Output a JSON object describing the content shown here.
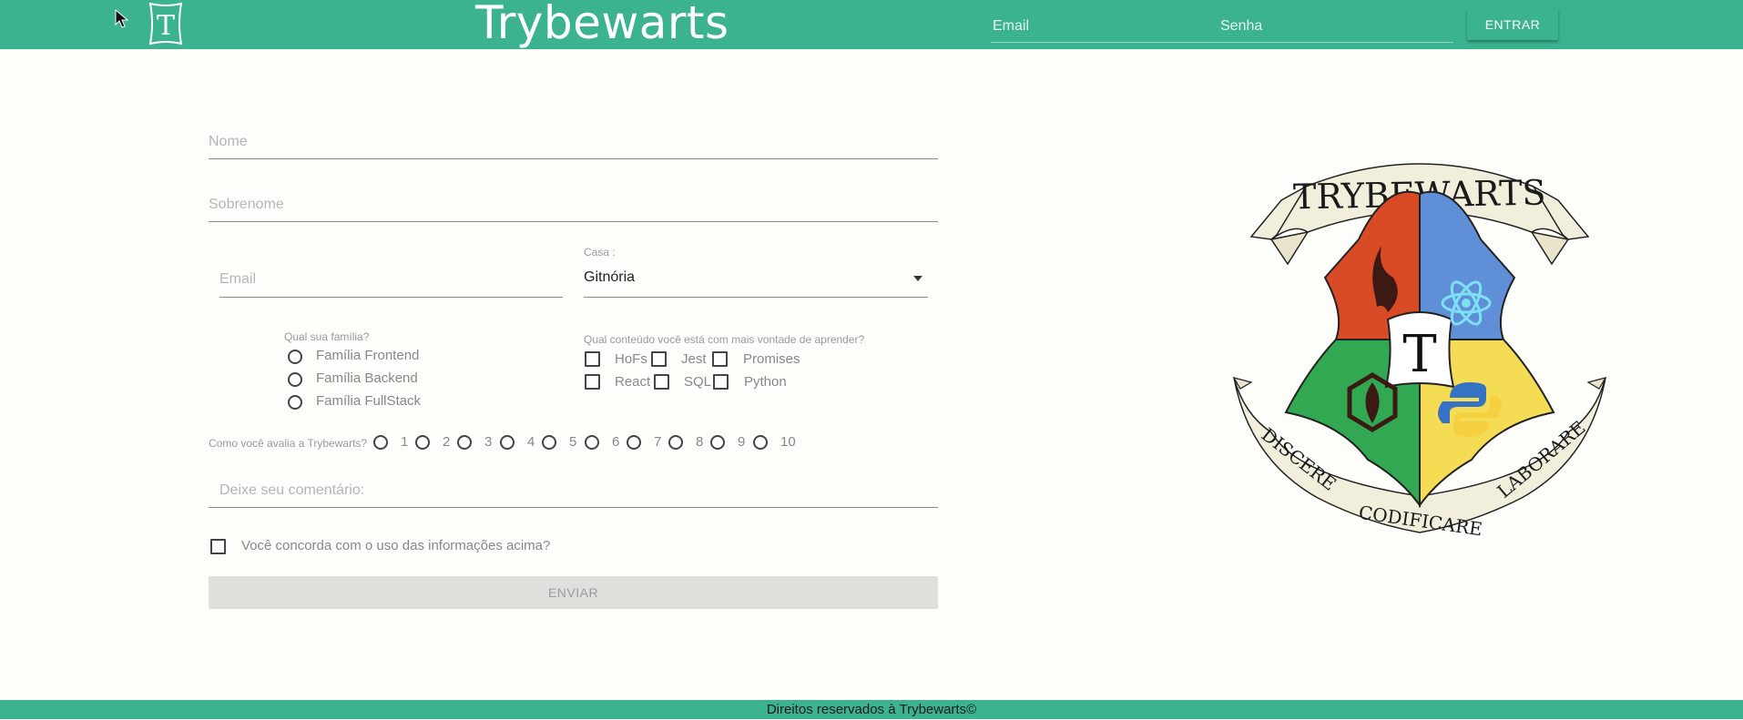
{
  "header": {
    "brand": "Trybewarts",
    "logo_letter": "T",
    "email_placeholder": "Email",
    "password_placeholder": "Senha",
    "login_button": "ENTRAR"
  },
  "form": {
    "name_placeholder": "Nome",
    "surname_placeholder": "Sobrenome",
    "email_placeholder": "Email",
    "house_label": "Casa :",
    "house_selected": "Gitnória",
    "family_label": "Qual sua família?",
    "families": [
      "Família Frontend",
      "Família Backend",
      "Família FullStack"
    ],
    "subjects_label": "Qual conteúdo você está com mais vontade de aprender?",
    "subjects": [
      "HoFs",
      "Jest",
      "Promises",
      "React",
      "SQL",
      "Python"
    ],
    "rating_label": "Como você avalia a Trybewarts?",
    "ratings": [
      "1",
      "2",
      "3",
      "4",
      "5",
      "6",
      "7",
      "8",
      "9",
      "10"
    ],
    "comment_placeholder": "Deixe seu comentário:",
    "agreement_label": "Você concorda com o uso das informações acima?",
    "submit_button": "ENVIAR"
  },
  "crest": {
    "title": "TRYBEWARTS",
    "center_letter": "T",
    "motto_left": "DISCERE",
    "motto_center": "CODIFICARE",
    "motto_right": "LABORARE"
  },
  "footer": {
    "text": "Direitos reservados à Trybewarts©"
  },
  "colors": {
    "header": "#3bb38f",
    "background": "#fdfdf9",
    "crest_red": "#d94b26",
    "crest_blue": "#5f8fd6",
    "crest_green": "#33a852",
    "crest_yellow": "#f4dd55",
    "ribbon": "#f1efdc"
  }
}
